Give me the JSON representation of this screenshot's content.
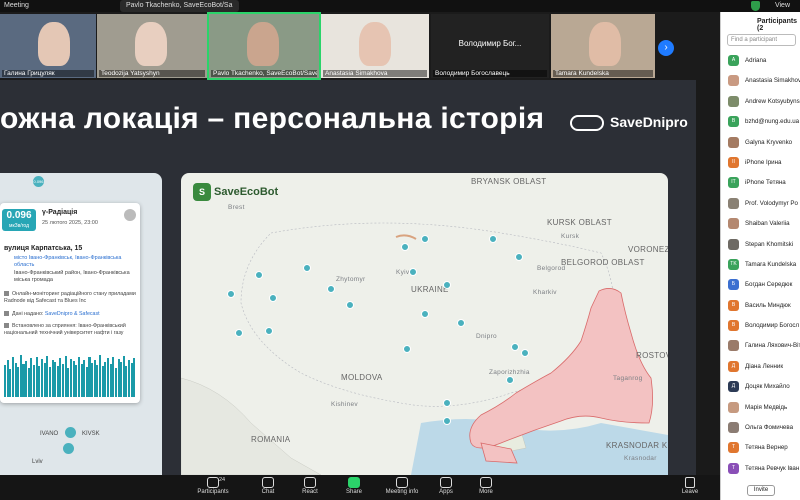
{
  "topbar": {
    "meeting_label": "Meeting",
    "speaker": "Pavlo Tkachenko, SaveEcoBot/Sa",
    "view_label": "View"
  },
  "gallery": [
    {
      "name": "Галина Грицуляк",
      "skin": "#e4c7b5",
      "bg": "#5a6a80"
    },
    {
      "name": "Teodozija Yatsyshyn",
      "skin": "#e8cfc0",
      "bg": "#a09c90"
    },
    {
      "name": "Pavlo Tkachenko, SaveEcoBot/Save...",
      "skin": "#caa58e",
      "bg": "#8a9a86"
    },
    {
      "name": "Anastasia Simakhova",
      "skin": "#e6c4b2",
      "bg": "#e8e4dd"
    },
    {
      "name": "Володимир Богославець",
      "skin": "",
      "bg": "#222222",
      "big": "Володимир Бог..."
    },
    {
      "name": "Tamara Kundelska",
      "skin": "#e0bca6",
      "bg": "#b9a894"
    }
  ],
  "slide": {
    "title": "ожна локація – персональна історія",
    "brand": "SaveDnipro"
  },
  "phone": {
    "badge_value": "0.096",
    "badge_unit": "мкЗв/год",
    "sensor_title": "γ-Радіація",
    "date": "25 лютого 2025, 23:00",
    "address": "вулиця Карпатська, 15",
    "location_link": "місто Івано-Франківськ, Івано-Франківська область",
    "location_detail": "Івано-Франківський район, Івано-Франківська міська громада",
    "info1": "Онлайн-моніторинг радіаційного стану приладами Radnode від Safecast та Blues Inc",
    "info2_prefix": "Дані надано: ",
    "info2_link": "SaveDnipro & Safecast",
    "info3": "Встановлено за сприяння: Івано-Франківський національний технічний університет нафти і газу",
    "city": "IVANO",
    "city2": "KIVSK",
    "city3": "Lviv",
    "dot_label": "0.096",
    "chart_bars": [
      0.72,
      0.85,
      0.64,
      0.91,
      0.78,
      0.69,
      0.95,
      0.74,
      0.82,
      0.67,
      0.88,
      0.73,
      0.9,
      0.7,
      0.86,
      0.77,
      0.93,
      0.68,
      0.84,
      0.79,
      0.71,
      0.89,
      0.76,
      0.94,
      0.66,
      0.87,
      0.81,
      0.72,
      0.92,
      0.75,
      0.83,
      0.69,
      0.9,
      0.78,
      0.85,
      0.73,
      0.96,
      0.7,
      0.8,
      0.88,
      0.74,
      0.91,
      0.67,
      0.86,
      0.79,
      0.93,
      0.71,
      0.84,
      0.77,
      0.89
    ]
  },
  "map": {
    "brand": "SaveEcoBot",
    "labels": {
      "brest": "Brest",
      "bryansk": "BRYANSK OBLAST",
      "kursk": "KURSK OBLAST",
      "kursk_city": "Kursk",
      "belgorod": "BELGOROD OBLAST",
      "belgorod_city": "Belgorod",
      "voronezh": "VORONEZH OBLAST",
      "ukraine": "UKRAINE",
      "kyiv": "Kyiv",
      "zhytomyr": "Zhytomyr",
      "kharkiv": "Kharkiv",
      "moldova": "MOLDOVA",
      "romania": "ROMANIA",
      "rostov": "ROSTOV OBLAST",
      "krasnodar": "KRASNODAR KRAI",
      "kishinev": "Kishinev",
      "zaporizhzhia": "Zaporizhzhia",
      "dnipro": "Dnipro",
      "taganrog": "Taganrog",
      "krasnodar_city": "Krasnodar"
    }
  },
  "participants": {
    "title": "Participants (2",
    "search_placeholder": "Find a participant",
    "invite_label": "Invite",
    "list": [
      {
        "name": "Adriana",
        "initials": "A",
        "color": "#3aa35b"
      },
      {
        "name": "Anastasia Simakhov",
        "initials": "",
        "color": "#c99a82"
      },
      {
        "name": "Andrew Kotsyubyns",
        "initials": "",
        "color": "#7d8c6a"
      },
      {
        "name": "bzhd@nung.edu.ua",
        "initials": "B",
        "color": "#3aa35b"
      },
      {
        "name": "Galyna Kryvenko",
        "initials": "",
        "color": "#a47b62"
      },
      {
        "name": "iPhone Ірина",
        "initials": "II",
        "color": "#e0762f"
      },
      {
        "name": "iPhone Тетяна",
        "initials": "IT",
        "color": "#3aa35b"
      },
      {
        "name": "Prof. Volodymyr Po",
        "initials": "",
        "color": "#8a8174"
      },
      {
        "name": "Shaiban Valeriia",
        "initials": "",
        "color": "#b48870"
      },
      {
        "name": "Stepan Khomitski",
        "initials": "",
        "color": "#6e6a64"
      },
      {
        "name": "Tamara Kundelska",
        "initials": "TK",
        "color": "#3aa35b"
      },
      {
        "name": "Богдан Середюк",
        "initials": "Б",
        "color": "#3b6fd0"
      },
      {
        "name": "Василь Миндюк",
        "initials": "В",
        "color": "#e0762f"
      },
      {
        "name": "Володимир Богосл",
        "initials": "В",
        "color": "#e0762f"
      },
      {
        "name": "Галина Ляхович-Вітв",
        "initials": "",
        "color": "#9a7b6a"
      },
      {
        "name": "Діана Ленник",
        "initials": "Д",
        "color": "#e0762f"
      },
      {
        "name": "Доцяк Михайло",
        "initials": "Д",
        "color": "#2c3a55"
      },
      {
        "name": "Марія Медвідь",
        "initials": "",
        "color": "#c69a80"
      },
      {
        "name": "Ольга Фомичева",
        "initials": "",
        "color": "#8b7c73"
      },
      {
        "name": "Тетяна Вернер",
        "initials": "Т",
        "color": "#e0762f"
      },
      {
        "name": "Тетяна Ревчук Іван",
        "initials": "Т",
        "color": "#8a4fb7"
      }
    ]
  },
  "toolbar": [
    {
      "label": "Participants",
      "count": "24",
      "icon": "participants-icon"
    },
    {
      "label": "Chat",
      "icon": "chat-icon"
    },
    {
      "label": "React",
      "icon": "react-icon"
    },
    {
      "label": "Share",
      "icon": "share-icon",
      "accent": true
    },
    {
      "label": "Meeting info",
      "icon": "info-icon"
    },
    {
      "label": "Apps",
      "icon": "apps-icon"
    },
    {
      "label": "More",
      "icon": "more-icon"
    }
  ],
  "leave_label": "Leave",
  "colors": {
    "accent": "#2bd46a",
    "brand_teal": "#27a6b5",
    "occupied": "#f3c2c2",
    "occupied_border": "#d96a6a"
  }
}
